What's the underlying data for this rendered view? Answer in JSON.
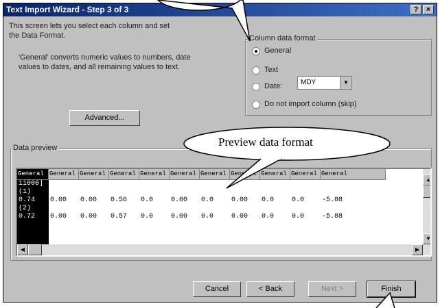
{
  "window": {
    "title": "Text Import Wizard - Step 3 of 3",
    "help_button": "?",
    "close_button": "×"
  },
  "intro": {
    "line1": "This screen lets you select each column and set",
    "line2": "the Data Format.",
    "desc1": "'General' converts numeric values to numbers, date",
    "desc2": "values to dates, and all remaining values to text."
  },
  "buttons": {
    "advanced": "Advanced...",
    "cancel": "Cancel",
    "back": "< Back",
    "next": "Next >",
    "finish": "Finish"
  },
  "column_format": {
    "title": "Column data format",
    "options": [
      "General",
      "Text",
      "Date:",
      "Do not import column (skip)"
    ],
    "selected": "General",
    "date_value": "MDY"
  },
  "preview": {
    "label": "Data preview",
    "headers": [
      "General",
      "General",
      "General",
      "General",
      "General",
      "General",
      "General",
      "General",
      "General",
      "General",
      "General"
    ],
    "rows": [
      [
        "11000]",
        "",
        "",
        "",
        "",
        "",
        "",
        "",
        "",
        "",
        ""
      ],
      [
        "(1)",
        "",
        "",
        "",
        "",
        "",
        "",
        "",
        "",
        "",
        ""
      ],
      [
        "0.74",
        "0.00",
        "0.00",
        "0.56",
        "0.0",
        "0.00",
        "0.0",
        "0.00",
        "0.0",
        "0.0",
        "-5.88"
      ],
      [
        "(2)",
        "",
        "",
        "",
        "",
        "",
        "",
        "",
        "",
        "",
        ""
      ],
      [
        "0.72",
        "0.00",
        "0.00",
        "0.57",
        "0.0",
        "0.00",
        "0.0",
        "0.00",
        "0.0",
        "0.0",
        "-5.88"
      ]
    ]
  },
  "callout": {
    "text": "Preview data format"
  },
  "icons": {
    "scroll_up": "▲",
    "scroll_down": "▼",
    "scroll_left": "◀",
    "scroll_right": "▶",
    "dropdown": "▼"
  }
}
